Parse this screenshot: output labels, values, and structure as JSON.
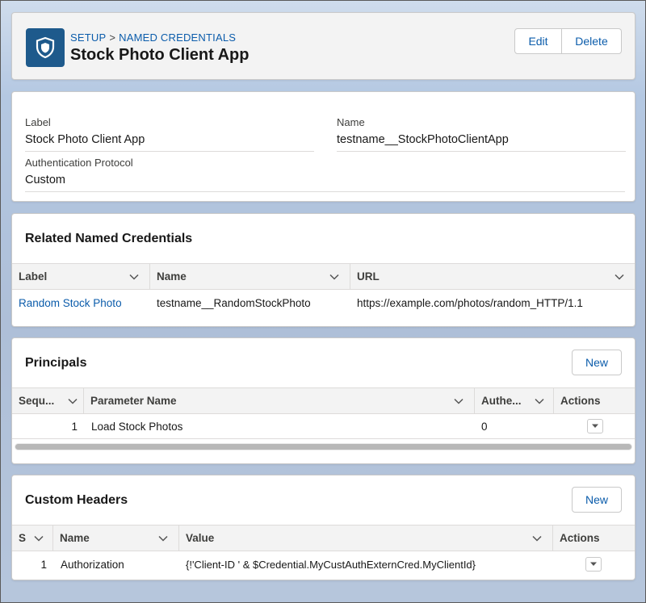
{
  "header": {
    "breadcrumb_root": "SETUP",
    "breadcrumb_separator": ">",
    "breadcrumb_section": "NAMED CREDENTIALS",
    "title": "Stock Photo Client App",
    "edit_label": "Edit",
    "delete_label": "Delete",
    "icon": "shield-icon"
  },
  "details": {
    "label_label": "Label",
    "label_value": "Stock Photo Client App",
    "name_label": "Name",
    "name_value": "testname__StockPhotoClientApp",
    "auth_label": "Authentication Protocol",
    "auth_value": "Custom"
  },
  "related": {
    "title": "Related Named Credentials",
    "columns": [
      "Label",
      "Name",
      "URL"
    ],
    "rows": [
      {
        "label": "Random Stock Photo",
        "name": "testname__RandomStockPhoto",
        "url": "https://example.com/photos/random_HTTP/1.1"
      }
    ]
  },
  "principals": {
    "title": "Principals",
    "new_label": "New",
    "columns": [
      "Sequ...",
      "Parameter Name",
      "Authe...",
      "Actions"
    ],
    "rows": [
      {
        "sequence": "1",
        "parameter_name": "Load Stock Photos",
        "auth": "0"
      }
    ]
  },
  "custom_headers": {
    "title": "Custom Headers",
    "new_label": "New",
    "columns": [
      "S",
      "Name",
      "Value",
      "Actions"
    ],
    "rows": [
      {
        "seq": "1",
        "name": "Authorization",
        "value": "{!'Client-ID ' & $Credential.MyCustAuthExternCred.MyClientId}"
      }
    ]
  },
  "colors": {
    "accent": "#0b5cab",
    "icon_bg": "#1e5a8c"
  }
}
